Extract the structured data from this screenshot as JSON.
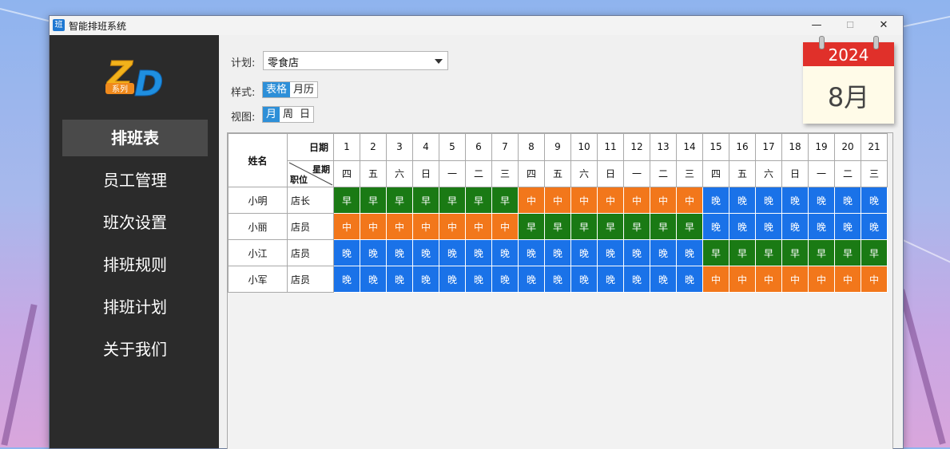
{
  "window": {
    "title": "智能排班系统",
    "icon_char": "班",
    "minimize": "—",
    "maximize": "☐",
    "close": "✕"
  },
  "logo": {
    "letters": "ZD",
    "tag": "系列"
  },
  "sidebar": {
    "items": [
      {
        "label": "排班表",
        "active": true
      },
      {
        "label": "员工管理"
      },
      {
        "label": "班次设置"
      },
      {
        "label": "排班规则"
      },
      {
        "label": "排班计划"
      },
      {
        "label": "关于我们"
      }
    ]
  },
  "controls": {
    "plan_label": "计划:",
    "plan_value": "零食店",
    "style_label": "样式:",
    "style_options": [
      "表格",
      "月历"
    ],
    "style_selected": "表格",
    "view_label": "视图:",
    "view_options": [
      "月",
      "周",
      "日"
    ],
    "view_selected": "月"
  },
  "calendar": {
    "year": "2024",
    "month": "8月"
  },
  "table": {
    "header_name": "姓名",
    "header_date": "日期",
    "header_weekday": "星期",
    "header_position": "职位",
    "days": [
      "1",
      "2",
      "3",
      "4",
      "5",
      "6",
      "7",
      "8",
      "9",
      "10",
      "11",
      "12",
      "13",
      "14",
      "15",
      "16",
      "17",
      "18",
      "19",
      "20",
      "21"
    ],
    "weekdays": [
      "四",
      "五",
      "六",
      "日",
      "一",
      "二",
      "三",
      "四",
      "五",
      "六",
      "日",
      "一",
      "二",
      "三",
      "四",
      "五",
      "六",
      "日",
      "一",
      "二",
      "三"
    ],
    "rows": [
      {
        "name": "小明",
        "position": "店长",
        "shifts": [
          "早",
          "早",
          "早",
          "早",
          "早",
          "早",
          "早",
          "中",
          "中",
          "中",
          "中",
          "中",
          "中",
          "中",
          "晚",
          "晚",
          "晚",
          "晚",
          "晚",
          "晚",
          "晚"
        ]
      },
      {
        "name": "小丽",
        "position": "店员",
        "shifts": [
          "中",
          "中",
          "中",
          "中",
          "中",
          "中",
          "中",
          "早",
          "早",
          "早",
          "早",
          "早",
          "早",
          "早",
          "晚",
          "晚",
          "晚",
          "晚",
          "晚",
          "晚",
          "晚"
        ]
      },
      {
        "name": "小江",
        "position": "店员",
        "shifts": [
          "晚",
          "晚",
          "晚",
          "晚",
          "晚",
          "晚",
          "晚",
          "晚",
          "晚",
          "晚",
          "晚",
          "晚",
          "晚",
          "晚",
          "早",
          "早",
          "早",
          "早",
          "早",
          "早",
          "早"
        ]
      },
      {
        "name": "小军",
        "position": "店员",
        "shifts": [
          "晚",
          "晚",
          "晚",
          "晚",
          "晚",
          "晚",
          "晚",
          "晚",
          "晚",
          "晚",
          "晚",
          "晚",
          "晚",
          "晚",
          "中",
          "中",
          "中",
          "中",
          "中",
          "中",
          "中"
        ]
      }
    ]
  },
  "colors": {
    "早": "#1a7a14",
    "中": "#f2771b",
    "晚": "#1a72e8",
    "accent": "#2d8fd8",
    "calendar_red": "#e0302a"
  }
}
